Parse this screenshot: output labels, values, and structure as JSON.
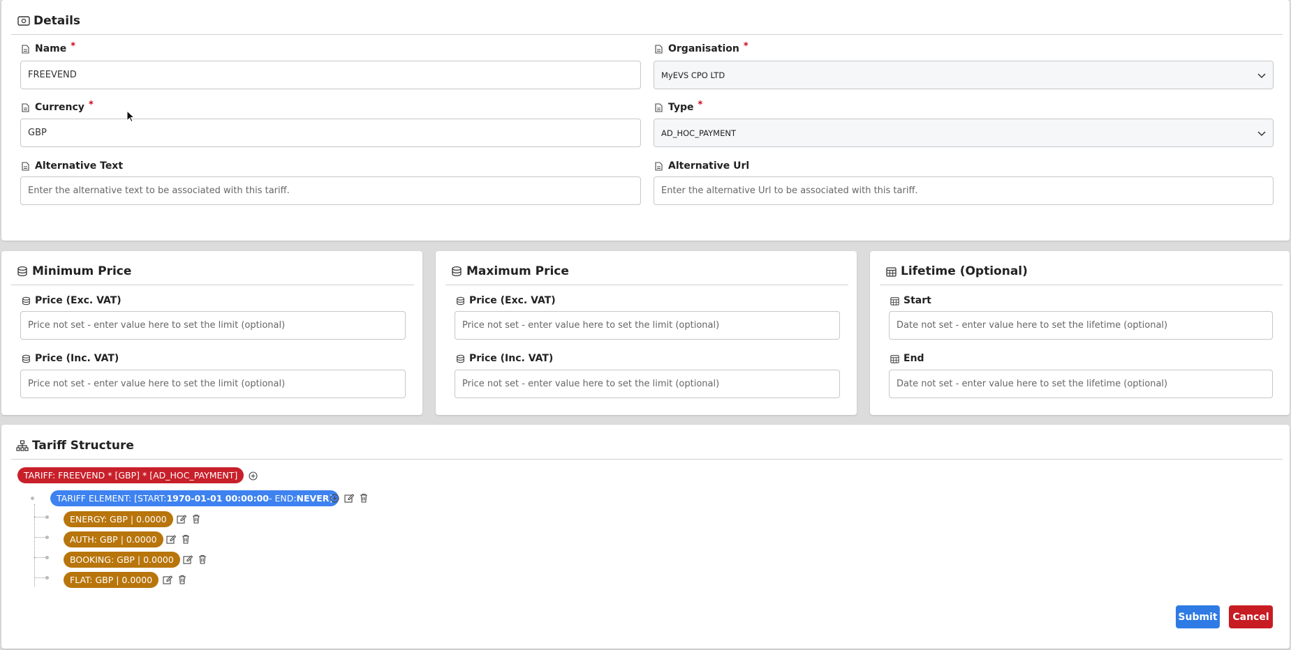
{
  "details": {
    "title": "Details",
    "name": {
      "label": "Name",
      "required": "*",
      "value": "FREEVEND"
    },
    "organisation": {
      "label": "Organisation",
      "required": "*",
      "value": "MyEVS CPO LTD"
    },
    "currency": {
      "label": "Currency",
      "required": "*",
      "value": "GBP"
    },
    "type": {
      "label": "Type",
      "required": "*",
      "value": "AD_HOC_PAYMENT"
    },
    "alt_text": {
      "label": "Alternative Text",
      "placeholder": "Enter the alternative text to be associated with this tariff."
    },
    "alt_url": {
      "label": "Alternative Url",
      "placeholder": "Enter the alternative Url to be associated with this tariff."
    }
  },
  "min_price": {
    "title": "Minimum Price",
    "exc": {
      "label": "Price (Exc. VAT)",
      "placeholder": "Price not set - enter value here to set the limit (optional)"
    },
    "inc": {
      "label": "Price (Inc. VAT)",
      "placeholder": "Price not set - enter value here to set the limit (optional)"
    }
  },
  "max_price": {
    "title": "Maximum Price",
    "exc": {
      "label": "Price (Exc. VAT)",
      "placeholder": "Price not set - enter value here to set the limit (optional)"
    },
    "inc": {
      "label": "Price (Inc. VAT)",
      "placeholder": "Price not set - enter value here to set the limit (optional)"
    }
  },
  "lifetime": {
    "title": "Lifetime (Optional)",
    "start": {
      "label": "Start",
      "placeholder": "Date not set - enter value here to set the lifetime (optional)"
    },
    "end": {
      "label": "End",
      "placeholder": "Date not set - enter value here to set the lifetime (optional)"
    }
  },
  "structure": {
    "title": "Tariff Structure",
    "root": "TARIFF: FREEVEND * [GBP] * [AD_HOC_PAYMENT]",
    "element": {
      "prefix": "TARIFF ELEMENT: [START: ",
      "start": "1970-01-01 00:00:00",
      "mid": " - END: ",
      "end": "NEVER",
      "suffix": "]"
    },
    "components": [
      "ENERGY: GBP | 0.0000",
      "AUTH: GBP | 0.0000",
      "BOOKING: GBP | 0.0000",
      "FLAT: GBP | 0.0000"
    ]
  },
  "actions": {
    "submit": "Submit",
    "cancel": "Cancel"
  },
  "colors": {
    "red": "#c8202a",
    "blue": "#3d82f0",
    "orange": "#b8750b",
    "submit": "#2f7ae5",
    "cancel": "#c71c22"
  }
}
